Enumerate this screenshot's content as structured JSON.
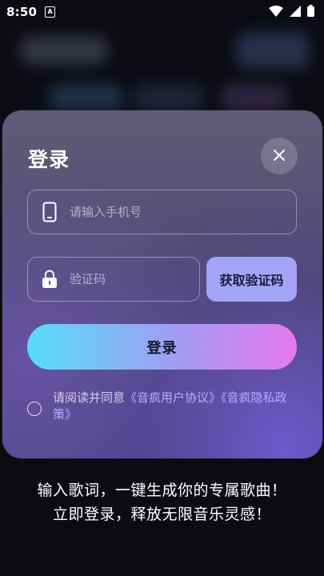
{
  "status_bar": {
    "time": "8:50",
    "notif_glyph": "A"
  },
  "login": {
    "title": "登录",
    "phone_placeholder": "请输入手机号",
    "code_placeholder": "验证码",
    "get_code_label": "获取验证码",
    "submit_label": "登录",
    "agree_prefix": "请阅读并同意",
    "agree_link1": "《音疯用户协议》",
    "agree_link2": "《音疯隐私政策》"
  },
  "slogan": {
    "line1": "输入歌词，一键生成你的专属歌曲！",
    "line2": "立即登录，释放无限音乐灵感！"
  },
  "colors": {
    "accent": "#a2a4f5",
    "gradient_start": "#56def8",
    "gradient_end": "#e679ef",
    "link": "#b2adff"
  },
  "icons": [
    "phone-icon",
    "lock-icon",
    "close-icon",
    "wifi-icon",
    "signal-icon",
    "battery-icon"
  ]
}
